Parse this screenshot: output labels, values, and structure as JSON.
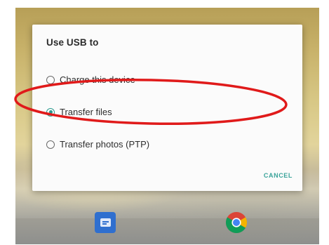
{
  "dialog": {
    "title": "Use USB to",
    "options": [
      {
        "label": "Charge this device",
        "selected": false
      },
      {
        "label": "Transfer files",
        "selected": true
      },
      {
        "label": "Transfer photos (PTP)",
        "selected": false
      }
    ],
    "cancel_label": "CANCEL"
  },
  "annotation": {
    "color": "#e01a1a"
  },
  "dock": {
    "icons": [
      "messages-icon",
      "chrome-icon"
    ]
  },
  "colors": {
    "accent": "#2a9a8e"
  }
}
